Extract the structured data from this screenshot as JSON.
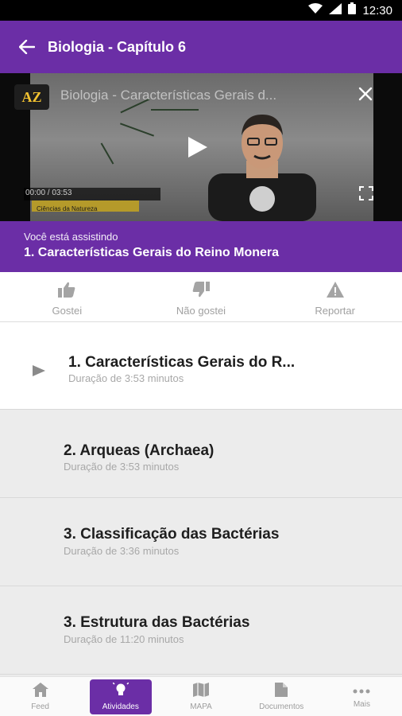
{
  "status_bar": {
    "time": "12:30",
    "icons": [
      "wifi-icon",
      "signal-icon",
      "battery-icon"
    ]
  },
  "app_bar": {
    "title": "Biologia - Capítulo 6",
    "back_icon": "arrow-left-icon"
  },
  "video": {
    "logo_text": "AZ",
    "title": "Biologia - Características Gerais d...",
    "time_display": "00:00 / 03:53",
    "ribbon_text": "Ciências da Natureza",
    "icons": [
      "close-icon",
      "play-icon",
      "fullscreen-icon"
    ]
  },
  "now_playing": {
    "label": "Você está assistindo",
    "current": "1. Características Gerais do Reino Monera"
  },
  "actions": [
    {
      "label": "Gostei",
      "icon": "thumbs-up-icon"
    },
    {
      "label": "Não gostei",
      "icon": "thumbs-down-icon"
    },
    {
      "label": "Reportar",
      "icon": "warning-icon"
    }
  ],
  "lessons": [
    {
      "title": "1. Características Gerais do R...",
      "duration": "Duração de 3:53 minutos",
      "active": true
    },
    {
      "title": "2. Arqueas (Archaea)",
      "duration": "Duração de 3:53 minutos",
      "active": false
    },
    {
      "title": "3. Classificação das Bactérias",
      "duration": "Duração de 3:36 minutos",
      "active": false
    },
    {
      "title": "3. Estrutura das Bactérias",
      "duration": "Duração de 11:20 minutos",
      "active": false
    }
  ],
  "bottom_nav": [
    {
      "label": "Feed",
      "icon": "home-icon",
      "active": false
    },
    {
      "label": "Atividades",
      "icon": "lightbulb-icon",
      "active": true
    },
    {
      "label": "MAPA",
      "icon": "map-icon",
      "active": false
    },
    {
      "label": "Documentos",
      "icon": "document-icon",
      "active": false
    },
    {
      "label": "Mais",
      "icon": "more-icon",
      "active": false
    }
  ],
  "colors": {
    "primary": "#6b2ea6",
    "list_background": "#ececec",
    "muted_text": "#a8a8a8"
  }
}
